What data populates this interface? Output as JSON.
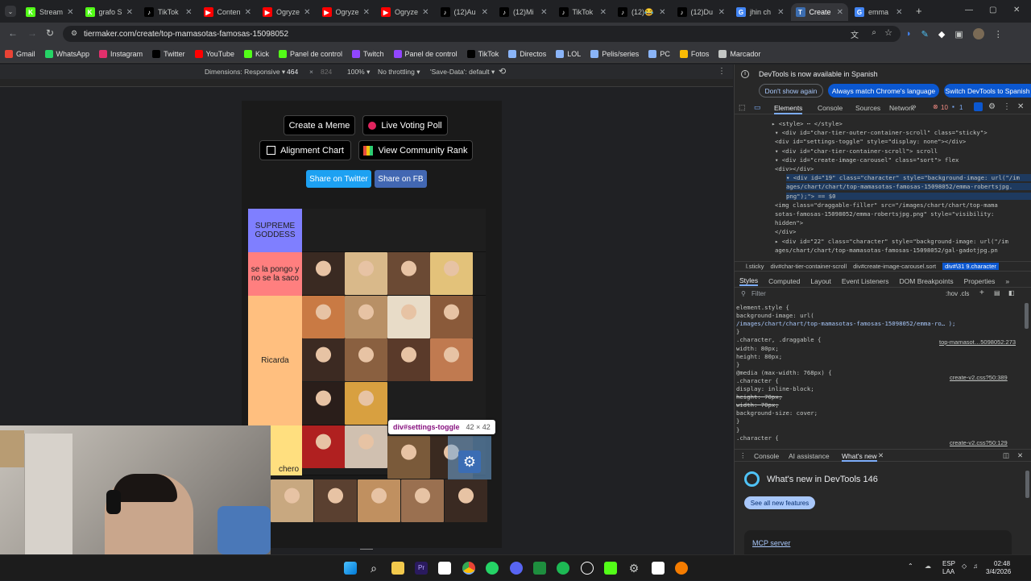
{
  "tabs": [
    {
      "title": "Stream",
      "color": "#53fc18",
      "letter": "K"
    },
    {
      "title": "grafo S",
      "color": "#53fc18",
      "letter": "K"
    },
    {
      "title": "TikTok",
      "color": "#010101",
      "letter": "♪"
    },
    {
      "title": "Conten",
      "color": "#ff0000",
      "letter": "▶"
    },
    {
      "title": "Ogryze",
      "color": "#ff0000",
      "letter": "▶"
    },
    {
      "title": "Ogryze",
      "color": "#ff0000",
      "letter": "▶"
    },
    {
      "title": "Ogryze",
      "color": "#ff0000",
      "letter": "▶"
    },
    {
      "title": "(12)Au",
      "color": "#010101",
      "letter": "♪"
    },
    {
      "title": "(12)Mi",
      "color": "#010101",
      "letter": "♪"
    },
    {
      "title": "TikTok",
      "color": "#010101",
      "letter": "♪"
    },
    {
      "title": "(12)😂",
      "color": "#010101",
      "letter": "♪"
    },
    {
      "title": "(12)Du",
      "color": "#010101",
      "letter": "♪"
    },
    {
      "title": "jhin ch",
      "color": "#4285f4",
      "letter": "G"
    },
    {
      "title": "Create",
      "color": "#3c6db0",
      "letter": "T"
    },
    {
      "title": "emma",
      "color": "#4285f4",
      "letter": "G"
    }
  ],
  "url": "tiermaker.com/create/top-mamasotas-famosas-15098052",
  "bookmarks": [
    "Gmail",
    "WhatsApp",
    "Instagram",
    "Twitter",
    "YouTube",
    "Kick",
    "Panel de control",
    "Twitch",
    "Panel de control",
    "TikTok",
    "Directos",
    "LOL",
    "Pelis/series",
    "PC",
    "Fotos",
    "Marcador"
  ],
  "bookmark_colors": [
    "#ea4335",
    "#25d366",
    "#e1306c",
    "#000000",
    "#ff0000",
    "#53fc18",
    "#53fc18",
    "#9146ff",
    "#9146ff",
    "#010101",
    "#8ab4f8",
    "#8ab4f8",
    "#8ab4f8",
    "#8ab4f8",
    "#fbbc04",
    "#c4c7c5"
  ],
  "device_toolbar": {
    "dimensions": "Dimensions: Responsive ▾",
    "width": "464",
    "height": "824",
    "zoom": "100% ▾",
    "throttle": "No throttling ▾",
    "save_data": "'Save-Data': default ▾"
  },
  "page": {
    "btn_meme": "Create a Meme",
    "btn_poll": "Live Voting Poll",
    "btn_alignment": "Alignment Chart",
    "btn_community": "View Community Rank",
    "share_twitter": "Share on Twitter",
    "share_fb": "Share on FB",
    "tiers": [
      {
        "label": "SUPREME GODDESS",
        "color": "#7f7fff"
      },
      {
        "label": "se la pongo y no se la saco",
        "color": "#ff7f7f"
      },
      {
        "label": "Ricarda",
        "color": "#ffbf7f"
      },
      {
        "label": "chero",
        "color": "#ffdf7f"
      }
    ],
    "tooltip": "div#settings-toggle",
    "tooltip_size": "42 × 42"
  },
  "devtools": {
    "banner": "DevTools is now available in Spanish",
    "btn_dont_show": "Don't show again",
    "btn_match": "Always match Chrome's language",
    "btn_switch": "Switch DevTools to Spanish",
    "tabs": [
      "Elements",
      "Console",
      "Sources",
      "Network"
    ],
    "errors": "10",
    "messages": "1",
    "code_lines": [
      "▸ <style> ⋯ </style>",
      "▾ <div id=\"char-tier-outer-container-scroll\" class=\"sticky\">",
      "  <div id=\"settings-toggle\" style=\"display: none\"></div>",
      "▾ <div id=\"char-tier-container-scroll\"> scroll",
      "  ▾ <div id=\"create-image-carousel\" class=\"sort\"> flex",
      "     <div></div>",
      "   ▾ <div id=\"19\" class=\"character\" style=\"background-image: url(\"/im",
      "     ages/chart/chart/top-mamasotas-famosas-15098052/emma-robertsjpg.",
      "     png\");\"> == $0",
      "       <img class=\"draggable-filler\" src=\"/images/chart/chart/top-mama",
      "       sotas-famosas-15098052/emma-robertsjpg.png\" style=\"visibility:",
      "       hidden\">",
      "     </div>",
      "   ▸ <div id=\"22\" class=\"character\" style=\"background-image: url(\"/im",
      "     ages/chart/chart/top-mamasotas-famosas-15098052/gal-gadotjpg.pn"
    ],
    "breadcrumb": [
      "l.sticky",
      "div#char-tier-container-scroll",
      "div#create-image-carousel.sort",
      "div#\\31 9.character"
    ],
    "style_tabs": [
      "Styles",
      "Computed",
      "Layout",
      "Event Listeners",
      "DOM Breakpoints",
      "Properties"
    ],
    "filter_placeholder": "Filter",
    "hov_cls": ":hov .cls",
    "css_lines": [
      "element.style {",
      "  background-image: url(",
      "    /images/chart/chart/top-mamasotas-famosas-15098052/emma-ro… );",
      "}",
      ".character, .draggable {",
      "  width: 80px;",
      "  height: 80px;",
      "}",
      "@media (max-width: 768px) {",
      ".character {",
      "  display: inline-block;",
      "  height: 70px;",
      "  width: 70px;",
      "  background-size: cover;",
      "}",
      "}",
      ".character {"
    ],
    "css_sources": [
      "top-mamasot…5098052:273",
      "create-v2.css?50:389",
      "create-v2.css?50:129"
    ],
    "drawer_tabs": [
      "Console",
      "AI assistance",
      "What's new"
    ],
    "whats_new_title": "What's new in DevTools 146",
    "see_features": "See all new features",
    "mcp_link": "MCP server"
  },
  "taskbar": {
    "lang1": "ESP",
    "lang2": "LAA",
    "time": "02:48",
    "date": "3/4/2026"
  }
}
